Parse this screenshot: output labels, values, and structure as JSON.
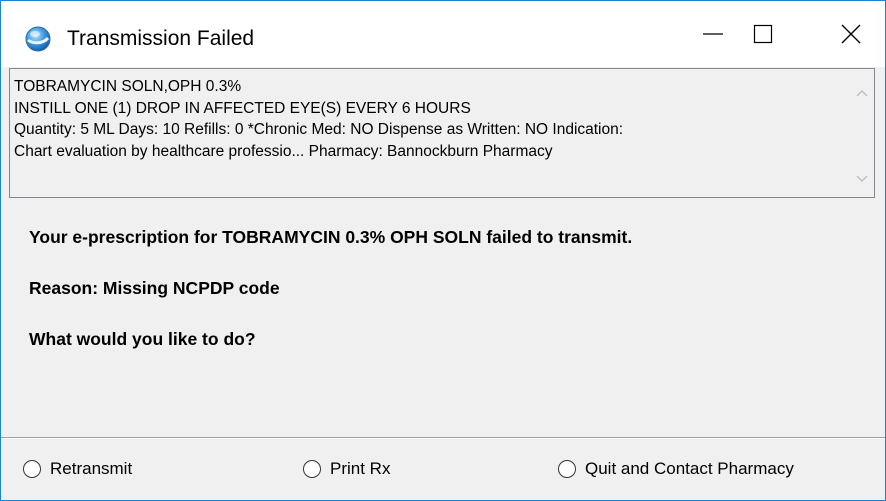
{
  "window": {
    "title": "Transmission Failed"
  },
  "prescription": {
    "lines": [
      "TOBRAMYCIN SOLN,OPH  0.3%",
      "INSTILL ONE (1) DROP IN AFFECTED EYE(S) EVERY 6 HOURS",
      "Quantity: 5 ML Days: 10 Refills: 0 *Chronic Med: NO Dispense as Written: NO Indication:",
      "Chart evaluation by healthcare professio... Pharmacy: Bannockburn Pharmacy"
    ]
  },
  "message": {
    "error": "Your e-prescription for TOBRAMYCIN 0.3% OPH SOLN failed to transmit.",
    "reason": "Reason: Missing NCPDP code",
    "question": "What would you like to do?"
  },
  "options": [
    {
      "label": "Retransmit",
      "selected": false
    },
    {
      "label": "Print Rx",
      "selected": false
    },
    {
      "label": "Quit and Contact Pharmacy",
      "selected": false
    }
  ],
  "colors": {
    "window_border": "#1883d7",
    "titlebar_bg": "#ffffff",
    "dialog_bg": "#f0f0f0",
    "text": "#000000"
  }
}
